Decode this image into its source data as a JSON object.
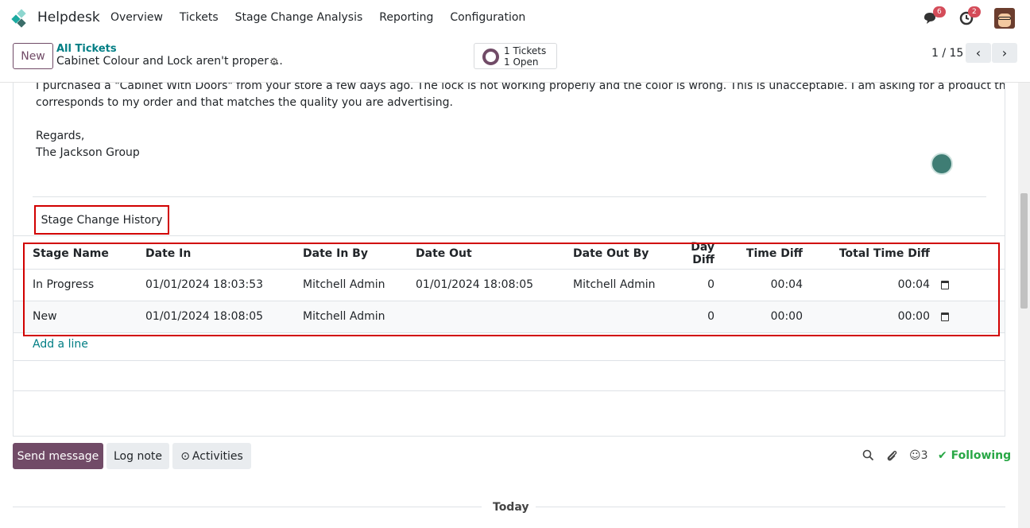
{
  "navbar": {
    "app_name": "Helpdesk",
    "menu": [
      "Overview",
      "Tickets",
      "Stage Change Analysis",
      "Reporting",
      "Configuration"
    ],
    "messages_count": "6",
    "activities_count": "2"
  },
  "control": {
    "new_label": "New",
    "breadcrumb_parent": "All Tickets",
    "breadcrumb_current": "Cabinet Colour and Lock aren't proper ...",
    "smart_tickets": "1 Tickets",
    "smart_open": "1 Open",
    "pager": "1 / 15"
  },
  "description": {
    "line1": "I purchased a \"Cabinet With Doors\" from your store a few days ago. The lock is not working properly and the color is wrong. This is unacceptable. I am asking for a product that",
    "line2": "corresponds to my order and that matches the quality you are advertising.",
    "regards": "Regards,",
    "signature": "The Jackson Group"
  },
  "tab": {
    "label": "Stage Change History"
  },
  "table": {
    "headers": [
      "Stage Name",
      "Date In",
      "Date In By",
      "Date Out",
      "Date Out By",
      "Day Diff",
      "Time Diff",
      "Total Time Diff"
    ],
    "rows": [
      [
        "In Progress",
        "01/01/2024 18:03:53",
        "Mitchell Admin",
        "01/01/2024 18:08:05",
        "Mitchell Admin",
        "0",
        "00:04",
        "00:04"
      ],
      [
        "New",
        "01/01/2024 18:08:05",
        "Mitchell Admin",
        "",
        "",
        "0",
        "00:00",
        "00:00"
      ]
    ],
    "add_line": "Add a line"
  },
  "chatter": {
    "send_message": "Send message",
    "log_note": "Log note",
    "activities": "Activities",
    "followers_count": "3",
    "following": "Following",
    "today": "Today"
  },
  "colors": {
    "brand": "#714b67",
    "link": "#017e84",
    "highlight": "#d10000",
    "following": "#28a745"
  }
}
